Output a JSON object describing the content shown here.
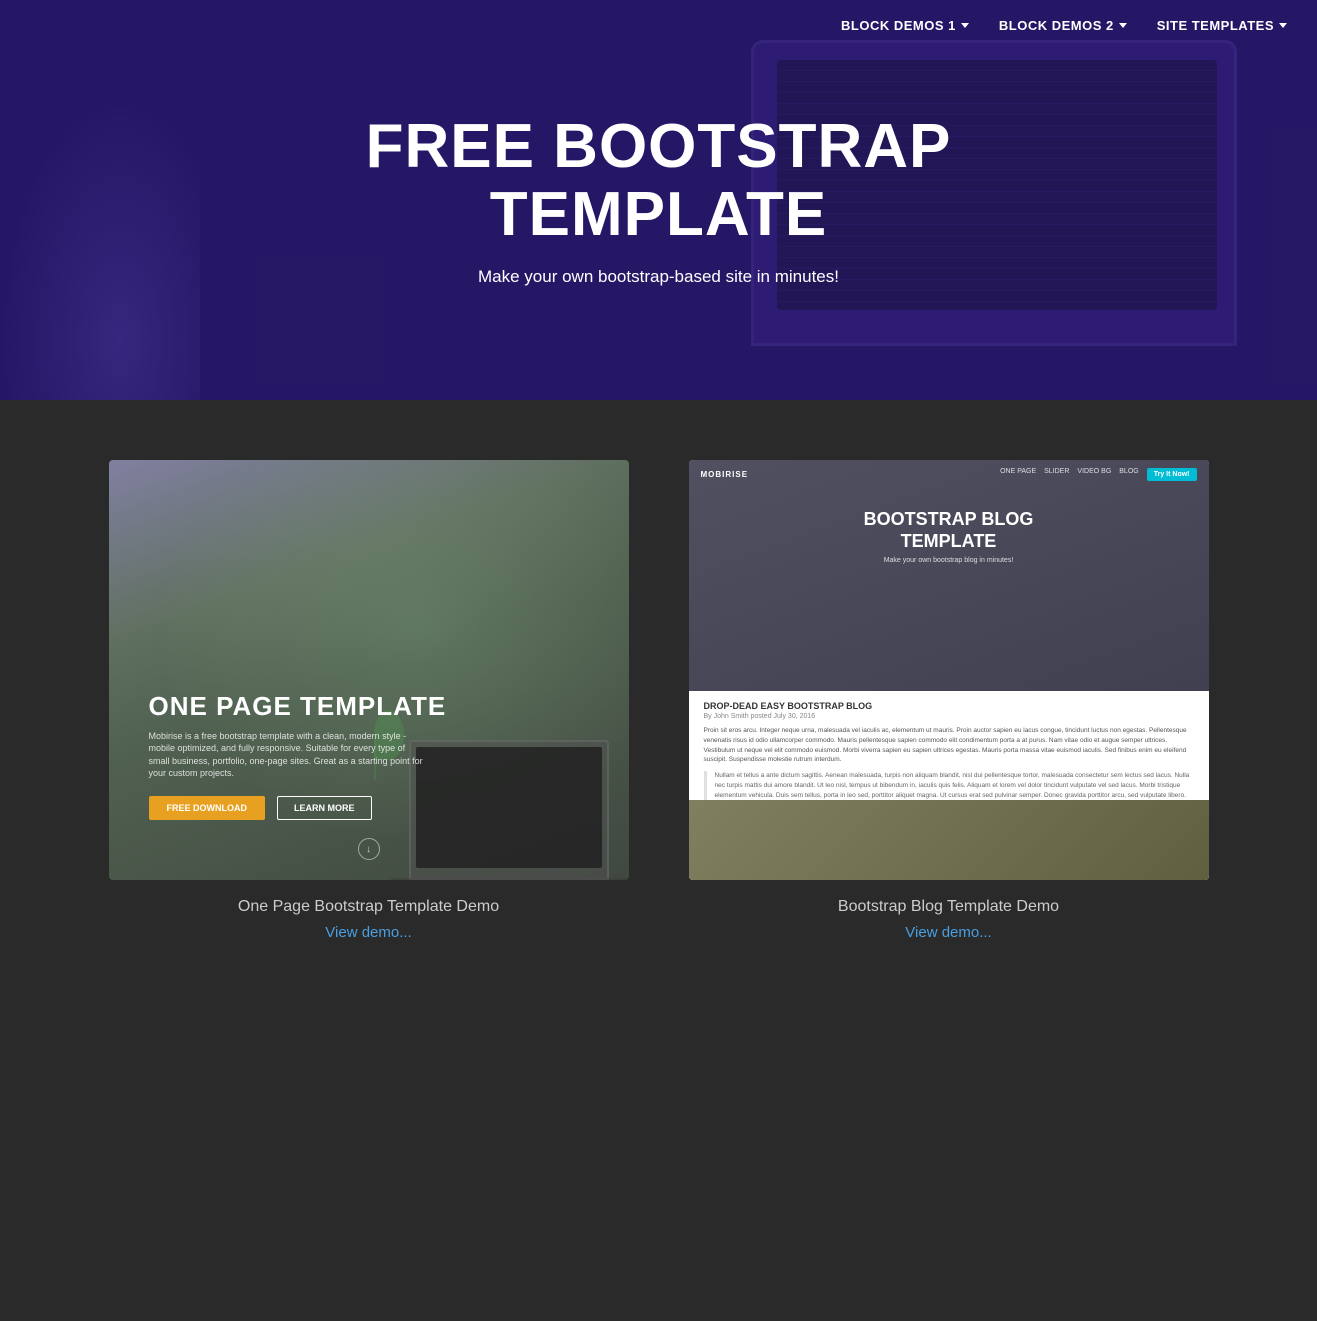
{
  "nav": {
    "items": [
      {
        "label": "BLOCK DEMOS 1",
        "id": "block-demos-1",
        "hasDropdown": true
      },
      {
        "label": "BLOCK DEMOS 2",
        "id": "block-demos-2",
        "hasDropdown": true
      },
      {
        "label": "SITE TEMPLATES",
        "id": "site-templates",
        "hasDropdown": true
      }
    ]
  },
  "hero": {
    "title": "FREE BOOTSTRAP TEMPLATE",
    "subtitle": "Make your own bootstrap-based site in minutes!"
  },
  "templates": [
    {
      "id": "one-page",
      "preview_label": "ONE PAGE TEMPLATE",
      "preview_sub": "Mobirise is a free bootstrap template with a clean, modern style - mobile optimized, and fully responsive. Suitable for every type of small business, portfolio, one-page sites. Great as a starting point for your custom projects.",
      "btn1": "FREE DOWNLOAD",
      "btn2": "LEARN MORE",
      "title": "One Page Bootstrap Template Demo",
      "link": "View demo..."
    },
    {
      "id": "blog",
      "nav_brand": "MOBIRISE",
      "nav_links": [
        "ONE PAGE",
        "SLIDER",
        "VIDEO BG",
        "BLOG"
      ],
      "try_btn": "Try It Now!",
      "blog_title": "BOOTSTRAP BLOG\nTEMPLATE",
      "blog_sub": "Make your own bootstrap blog in minutes!",
      "article_title": "DROP-DEAD EASY BOOTSTRAP BLOG",
      "article_meta": "By John Smith posted July 30, 2016",
      "article_text": "Proin sit eros arcu. Integer neque urna, malesuada vel iaculis ac, elementum ut mauris. Proin auctor sapien eu lacus congue, tincidunt luctus non egestas. Pellentesque venenatis risus id odio ullamcorper commodo. Mauris pellentesque sapien commodo elit condimentum porta a at purus. Nam vitae odio et augue semper ultrices. Vestibulum ut neque vel elit commodo euismod. Morbi viverra sapien eu sapien ultrices egestas. Mauris porta massa vitae euismod iaculis. Sed finibus enim eu eleifend suscipit. Suspendisse molestie rutrum interdum.",
      "blockquote": "Nullam et tellus a ante dictum sagittis. Aenean malesuada, turpis non aliquam blandit, nisl dui pellentesque tortor, malesuada consectetur sem lectus sed lacus. Nulla nec turpis mattis dui amore blandit. Ut leo nisl, tempus ut bibendum in, iaculis quis felis. Aliquam et lorem vel dolor tincidunt vulputate vel sed lacus. Morbi tristique elementum vehicula. Duis sem tellus, porta in leo sed, porttitor aliquet magna. Ut cursus erat sed pulvinar semper. Donec gravida porttitor arcu, sed vulputate libero. Morbi non justo ac tellus tempus ornare. Nam tortor augue, commodo eget lobortis non, consectetur eget arcu. In hoc habitasse platea dictumst. Nam congue odio neque, in tempus sapien faucibus non.",
      "title": "Bootstrap Blog Template Demo",
      "link": "View demo..."
    }
  ],
  "colors": {
    "accent_blue": "#4a9fe0",
    "hero_bg": "#3a2a6e",
    "page_bg": "#2a2a2a",
    "try_btn": "#00bcd4",
    "btn_orange": "#e8a020"
  }
}
